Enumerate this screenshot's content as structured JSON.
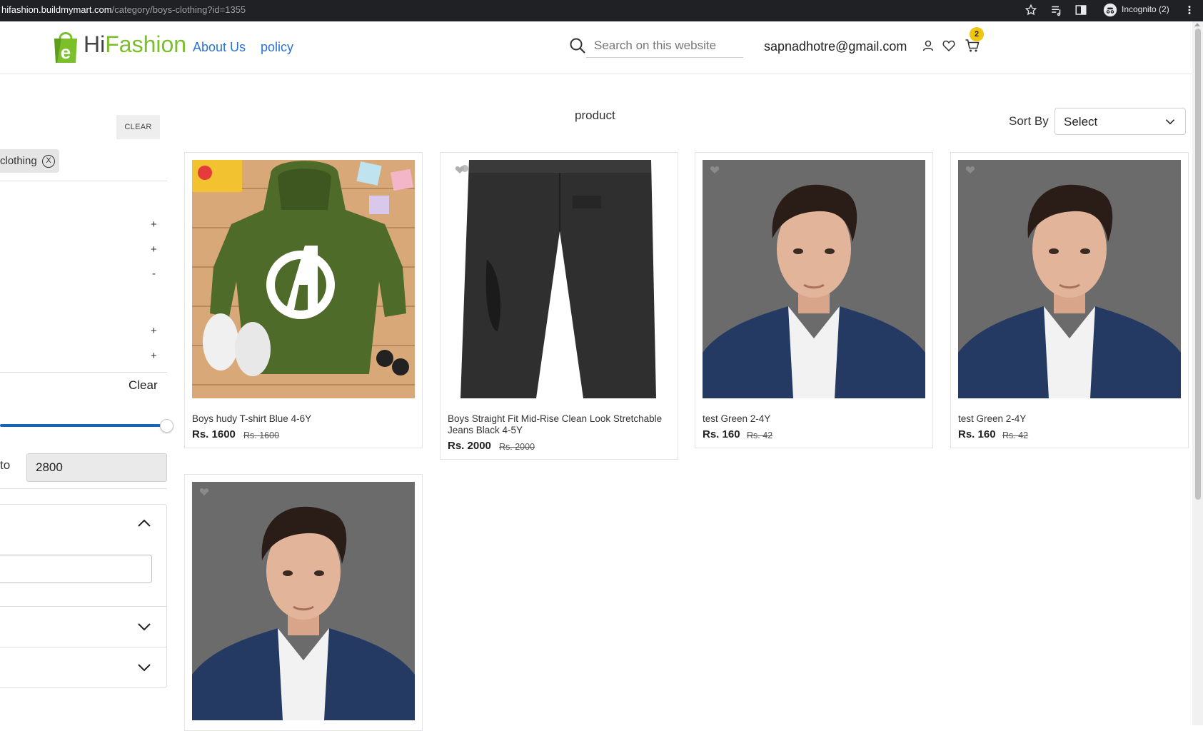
{
  "browser": {
    "url_host": "hifashion.buildmymart.com",
    "url_path": "/category/boys-clothing?id=1355",
    "incognito_label": "Incognito (2)"
  },
  "header": {
    "brand_hi": "Hi",
    "brand_fashion": "Fashion",
    "nav": [
      "About Us",
      "policy"
    ],
    "search_placeholder": "Search on this website",
    "user_email": "sapnadhotre@gmail.com",
    "cart_count": "2"
  },
  "sidebar": {
    "clear_all_label": "CLEAR",
    "active_filter_label": "clothing",
    "active_filter_remove": "X",
    "filter_toggles": [
      "+",
      "+",
      "-",
      "+",
      "+"
    ],
    "price_clear_label": "Clear",
    "price_to_label": "to",
    "price_max_value": "2800",
    "price_slider_max_fraction": 1.0
  },
  "main": {
    "heading": "product",
    "sort_label": "Sort By",
    "sort_value": "Select",
    "products": [
      {
        "name": "Boys hudy T-shirt Blue 4-6Y",
        "price": "Rs. 1600",
        "mrp": "Rs. 1600",
        "image": "green-hoodie-photo"
      },
      {
        "name": "Boys Straight Fit Mid-Rise Clean Look Stretchable Jeans Black 4-5Y",
        "price": "Rs. 2000",
        "mrp": "Rs. 2000",
        "image": "black-jeans-photo"
      },
      {
        "name": "test Green 2-4Y",
        "price": "Rs. 160",
        "mrp": "Rs. 42",
        "image": "male-model-photo"
      },
      {
        "name": "test Green 2-4Y",
        "price": "Rs. 160",
        "mrp": "Rs. 42",
        "image": "male-model-photo"
      },
      {
        "name": "",
        "price": "",
        "mrp": "",
        "image": "male-model-photo"
      }
    ]
  },
  "colors": {
    "brand_green": "#7bbf2a",
    "link_blue": "#2a72d6",
    "slider_blue": "#1565c0",
    "badge_yellow": "#f1c40f"
  }
}
